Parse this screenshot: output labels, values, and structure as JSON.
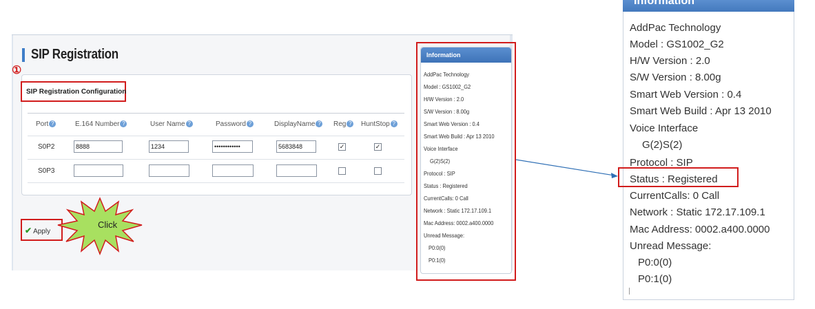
{
  "page": {
    "title": "SIP Registration",
    "step_marker": "①",
    "config_title": "SIP Registration Configuration"
  },
  "table": {
    "headers": [
      "Port",
      "E.164 Number",
      "User Name",
      "Password",
      "DisplayName",
      "Reg",
      "HuntStop"
    ],
    "help_icon": "?",
    "rows": [
      {
        "port": "S0P2",
        "e164": "8888",
        "username": "1234",
        "password": "••••••••••••",
        "displayname": "5683848",
        "reg": true,
        "huntstop": true
      },
      {
        "port": "S0P3",
        "e164": "",
        "username": "",
        "password": "",
        "displayname": "",
        "reg": false,
        "huntstop": false
      }
    ]
  },
  "apply": {
    "label": "Apply",
    "icon": "check-icon",
    "callout": "Click"
  },
  "info_small": {
    "header": "Information",
    "lines": [
      "AddPac Technology",
      "Model : GS1002_G2",
      "H/W Version : 2.0",
      "S/W Version : 8.00g",
      "Smart Web Version : 0.4",
      "Smart Web Build : Apr 13 2010",
      "Voice Interface",
      "G(2)S(2)",
      "Protocol : SIP",
      "Status : Registered",
      "CurrentCalls: 0 Call",
      "Network : Static 172.17.109.1",
      "Mac Address: 0002.a400.0000",
      "Unread Message:",
      "P0:0(0)",
      "P0:1(0)"
    ]
  },
  "info_zoom": {
    "header": "Information",
    "lines": [
      "AddPac Technology",
      "Model : GS1002_G2",
      "H/W Version : 2.0",
      "S/W Version : 8.00g",
      "Smart Web Version : 0.4",
      "Smart Web Build : Apr 13 2010",
      "Voice Interface",
      "G(2)S(2)",
      "Protocol : SIP",
      "Status : Registered",
      "CurrentCalls: 0 Call",
      "Network : Static 172.17.109.1",
      "Mac Address: 0002.a400.0000",
      "Unread Message:",
      "P0:0(0)",
      "P0:1(0)"
    ]
  },
  "colors": {
    "highlight": "#d11c1c",
    "accent": "#3f7ec8",
    "callout_fill": "#a8e060",
    "callout_stroke": "#d11c1c",
    "arrow": "#2f6fb5"
  }
}
